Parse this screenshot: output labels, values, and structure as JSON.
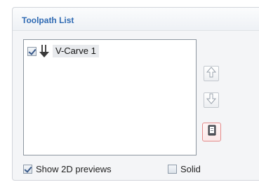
{
  "panel": {
    "title": "Toolpath List"
  },
  "toolpaths": [
    {
      "name": "V-Carve 1",
      "checked": true,
      "icon": "v-carve-tool-icon"
    }
  ],
  "side_buttons": [
    {
      "name": "move-up-button",
      "icon": "arrow-up-icon"
    },
    {
      "name": "move-down-button",
      "icon": "arrow-down-icon"
    },
    {
      "name": "toolpath-sheet-button",
      "icon": "sheet-icon"
    }
  ],
  "options": {
    "show_2d_previews": {
      "label": "Show 2D previews",
      "checked": true
    },
    "solid": {
      "label": "Solid",
      "checked": false
    }
  }
}
